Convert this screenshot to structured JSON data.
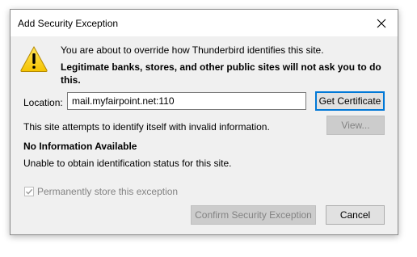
{
  "window": {
    "title": "Add Security Exception",
    "close_icon": "close-icon"
  },
  "message": {
    "icon": "warning-icon",
    "line1": "You are about to override how Thunderbird identifies this site.",
    "line2": "Legitimate banks, stores, and other public sites will not ask you to do",
    "line3": "this."
  },
  "location": {
    "label": "Location:",
    "value": "mail.myfairpoint.net:110",
    "button": "Get Certificate"
  },
  "status": {
    "invalid_text": "This site attempts to identify itself with invalid information.",
    "view_button": "View...",
    "heading": "No Information Available",
    "detail": "Unable to obtain identification status for this site."
  },
  "options": {
    "permanent_label": "Permanently store this exception",
    "permanent_checked": true,
    "permanent_disabled": true
  },
  "footer": {
    "confirm_button": "Confirm Security Exception",
    "cancel_button": "Cancel"
  },
  "colors": {
    "dialog_bg": "#f0f0f0",
    "focus_accent": "#0078d7",
    "disabled_text": "#838383",
    "warning_yellow": "#ffcc00"
  }
}
